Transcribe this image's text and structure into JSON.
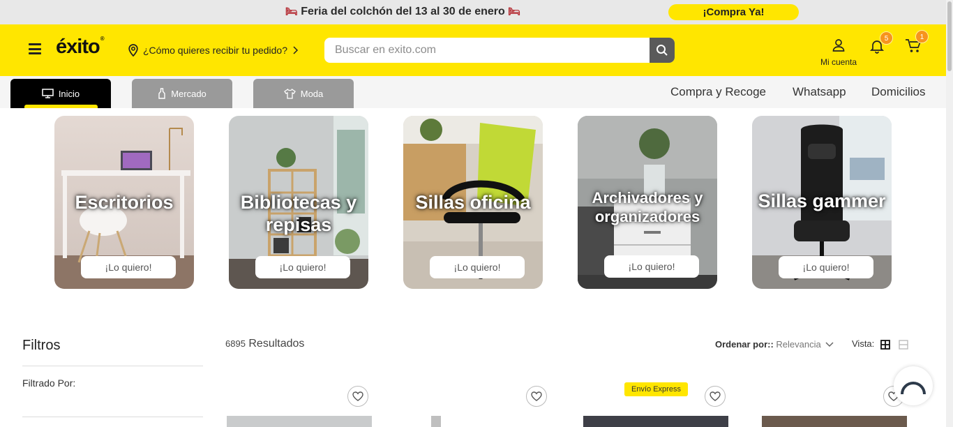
{
  "promo": {
    "text": "Feria del colchón del 13 al 30 de enero",
    "cta": "¡Compra Ya!"
  },
  "header": {
    "logo": "éxito",
    "logo_mark": "®",
    "location_prompt": "¿Cómo quieres recibir tu pedido?",
    "search_placeholder": "Buscar en exito.com",
    "account_label": "Mi cuenta",
    "notifications_count": "5",
    "cart_count": "1"
  },
  "nav": {
    "tabs": [
      {
        "label": "Inicio",
        "icon": "monitor-icon",
        "active": true
      },
      {
        "label": "Mercado",
        "icon": "bottle-icon",
        "active": false
      },
      {
        "label": "Moda",
        "icon": "shirt-icon",
        "active": false
      }
    ],
    "links": [
      "Compra y Recoge",
      "Whatsapp",
      "Domicilios"
    ]
  },
  "categories": [
    {
      "title": "Escritorios",
      "cta": "¡Lo quiero!"
    },
    {
      "title": "Bibliotecas y repisas",
      "cta": "¡Lo quiero!"
    },
    {
      "title": "Sillas oficina",
      "cta": "¡Lo quiero!"
    },
    {
      "title": "Archivadores y organizadores",
      "cta": "¡Lo quiero!"
    },
    {
      "title": "Sillas gammer",
      "cta": "¡Lo quiero!"
    }
  ],
  "listing": {
    "filters_title": "Filtros",
    "filtered_by": "Filtrado Por:",
    "results_count": "6895",
    "results_label": "Resultados",
    "sort_label": "Ordenar por::",
    "sort_value": "Relevancia",
    "view_label": "Vista:",
    "express_badge": "Envío Express"
  },
  "colors": {
    "brand_yellow": "#ffe600",
    "badge_orange": "#f7941d",
    "tab_active": "#000000",
    "tab_inactive": "#9a9a9a"
  }
}
